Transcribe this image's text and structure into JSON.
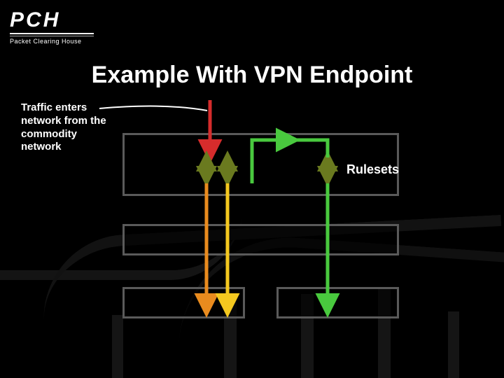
{
  "logo": {
    "name": "PCH",
    "tagline": "Packet Clearing House"
  },
  "title": "Example With VPN Endpoint",
  "annotations": {
    "traffic_in": "Traffic enters network from the commodity network",
    "rulesets": "Rulesets"
  },
  "colors": {
    "red": "#d62c2c",
    "orange": "#e98b1e",
    "yellow": "#f4c81f",
    "green": "#49c93e",
    "olive": "#6a7a1f",
    "box": "#5a5a5a"
  },
  "diagram": {
    "layers": [
      {
        "id": "perimeter",
        "label": ""
      },
      {
        "id": "middle",
        "label": ""
      },
      {
        "id": "internal-a",
        "label": ""
      },
      {
        "id": "internal-b",
        "label": ""
      }
    ],
    "flows": [
      {
        "id": "entry",
        "from": "outside",
        "to": "perimeter",
        "color": "red"
      },
      {
        "id": "orange",
        "from": "perimeter",
        "to": "internal-a",
        "passes_through": [
          "middle"
        ],
        "color": "orange"
      },
      {
        "id": "yellow",
        "from": "perimeter",
        "to": "internal-a",
        "passes_through": [
          "middle"
        ],
        "color": "yellow"
      },
      {
        "id": "green",
        "from": "perimeter",
        "to": "internal-b",
        "passes_through": [
          "middle"
        ],
        "color": "green",
        "has_jog": true
      }
    ],
    "ruleset_markers": 3
  }
}
